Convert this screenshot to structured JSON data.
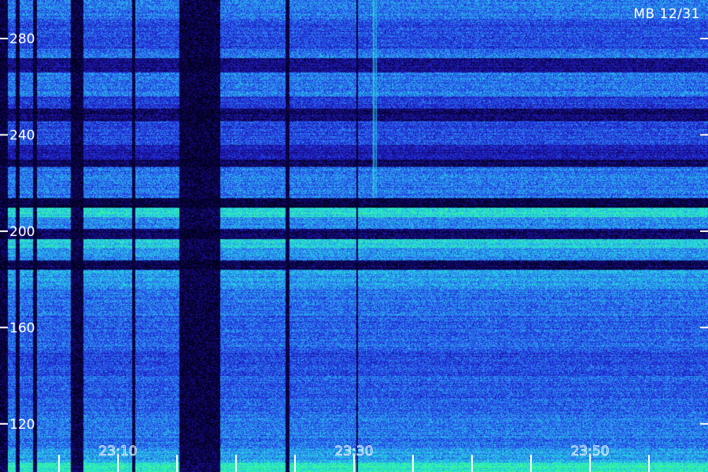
{
  "stamp": "MB 12/31",
  "chart_data": {
    "type": "heatmap",
    "title": "",
    "xlabel": "",
    "ylabel": "",
    "y_ticks": [
      {
        "value": 280,
        "label": "280"
      },
      {
        "value": 240,
        "label": "240"
      },
      {
        "value": 200,
        "label": "200"
      },
      {
        "value": 160,
        "label": "160"
      },
      {
        "value": 120,
        "label": "120"
      }
    ],
    "ylim": [
      100,
      296
    ],
    "x_time_labels": [
      {
        "minute": 10,
        "label": "23:10"
      },
      {
        "minute": 30,
        "label": "23:30"
      },
      {
        "minute": 50,
        "label": "23:50"
      }
    ],
    "x_minor_tick_minutes": [
      5,
      10,
      15,
      20,
      25,
      30,
      35,
      40,
      45,
      50,
      55
    ],
    "xlim_minutes": [
      0,
      60
    ],
    "colormap": [
      "#000018",
      "#1a0a8c",
      "#2030e0",
      "#2f8cf0",
      "#20e0e0",
      "#40ff80"
    ],
    "intensity_bands": [
      {
        "from": 296,
        "to": 288,
        "level": 0.55
      },
      {
        "from": 288,
        "to": 276,
        "level": 0.45
      },
      {
        "from": 276,
        "to": 272,
        "level": 0.55
      },
      {
        "from": 272,
        "to": 266,
        "level": 0.2
      },
      {
        "from": 266,
        "to": 256,
        "level": 0.55
      },
      {
        "from": 256,
        "to": 251,
        "level": 0.4
      },
      {
        "from": 251,
        "to": 246,
        "level": 0.15
      },
      {
        "from": 246,
        "to": 236,
        "level": 0.45
      },
      {
        "from": 236,
        "to": 230,
        "level": 0.3
      },
      {
        "from": 230,
        "to": 227,
        "level": 0.1
      },
      {
        "from": 227,
        "to": 214,
        "level": 0.55
      },
      {
        "from": 214,
        "to": 210,
        "level": 0.05
      },
      {
        "from": 210,
        "to": 206,
        "level": 0.82
      },
      {
        "from": 206,
        "to": 201,
        "level": 0.6
      },
      {
        "from": 201,
        "to": 197,
        "level": 0.12
      },
      {
        "from": 197,
        "to": 193,
        "level": 0.78
      },
      {
        "from": 193,
        "to": 188,
        "level": 0.6
      },
      {
        "from": 188,
        "to": 184,
        "level": 0.1
      },
      {
        "from": 184,
        "to": 176,
        "level": 0.65
      },
      {
        "from": 176,
        "to": 165,
        "level": 0.55
      },
      {
        "from": 165,
        "to": 150,
        "level": 0.5
      },
      {
        "from": 150,
        "to": 140,
        "level": 0.45
      },
      {
        "from": 140,
        "to": 125,
        "level": 0.5
      },
      {
        "from": 125,
        "to": 110,
        "level": 0.55
      },
      {
        "from": 110,
        "to": 104,
        "level": 0.65
      },
      {
        "from": 104,
        "to": 100,
        "level": 0.85
      }
    ],
    "dark_time_columns": [
      {
        "from_minute": 0.0,
        "to_minute": 0.6
      },
      {
        "from_minute": 1.3,
        "to_minute": 1.6
      },
      {
        "from_minute": 2.8,
        "to_minute": 3.1
      },
      {
        "from_minute": 6.0,
        "to_minute": 7.0
      },
      {
        "from_minute": 11.2,
        "to_minute": 11.4
      },
      {
        "from_minute": 15.2,
        "to_minute": 18.6
      },
      {
        "from_minute": 24.2,
        "to_minute": 24.5
      },
      {
        "from_minute": 30.2,
        "to_minute": 30.3
      }
    ],
    "bright_time_line_minute": 31.6
  }
}
